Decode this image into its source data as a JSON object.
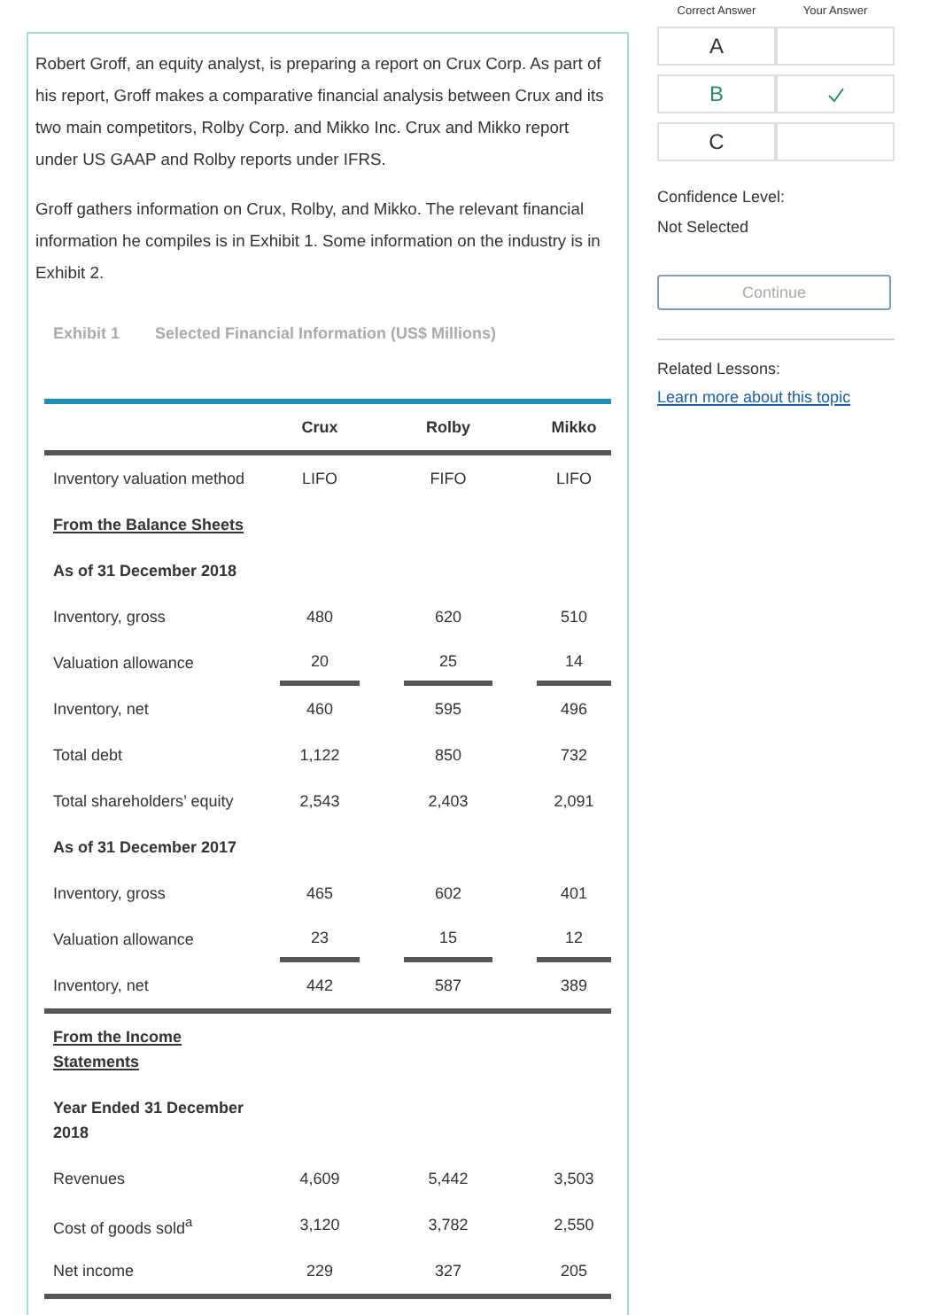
{
  "passage": {
    "paragraphs": [
      "Robert Groff, an equity analyst, is preparing a report on Crux Corp. As part of his report, Groff makes a comparative financial analysis between Crux and its two main competitors, Rolby Corp. and Mikko Inc. Crux and Mikko report under US GAAP and Rolby reports under IFRS.",
      "Groff gathers information on Crux, Rolby, and Mikko. The relevant financial information he compiles is in Exhibit 1. Some information on the industry is in Exhibit 2."
    ]
  },
  "exhibit": {
    "number": "Exhibit 1",
    "title": "Selected Financial Information (US$ Millions)",
    "table": {
      "columns": [
        "Crux",
        "Rolby",
        "Mikko"
      ],
      "rows": [
        {
          "kind": "data",
          "label": "Inventory valuation method",
          "values": [
            "LIFO",
            "FIFO",
            "LIFO"
          ]
        },
        {
          "kind": "section",
          "label": "From the Balance Sheets"
        },
        {
          "kind": "subheading",
          "label": "As of 31 December 2018"
        },
        {
          "kind": "data",
          "label": "Inventory, gross",
          "values": [
            "480",
            "620",
            "510"
          ]
        },
        {
          "kind": "data",
          "label": "Valuation allowance",
          "values": [
            "20",
            "25",
            "14"
          ],
          "subtotal_lines": true
        },
        {
          "kind": "data",
          "label": "Inventory, net",
          "values": [
            "460",
            "595",
            "496"
          ]
        },
        {
          "kind": "data",
          "label": "Total debt",
          "values": [
            "1,122",
            "850",
            "732"
          ]
        },
        {
          "kind": "data",
          "label": "Total shareholders’ equity",
          "values": [
            "2,543",
            "2,403",
            "2,091"
          ]
        },
        {
          "kind": "subheading",
          "label": "As of 31 December 2017"
        },
        {
          "kind": "data",
          "label": "Inventory, gross",
          "values": [
            "465",
            "602",
            "401"
          ]
        },
        {
          "kind": "data",
          "label": "Valuation allowance",
          "values": [
            "23",
            "15",
            "12"
          ],
          "subtotal_lines": true
        },
        {
          "kind": "data",
          "label": "Inventory, net",
          "values": [
            "442",
            "587",
            "389"
          ],
          "rule_below": true
        },
        {
          "kind": "section",
          "label": "From the Income Statements"
        },
        {
          "kind": "subheading",
          "label": "Year Ended 31 December 2018"
        },
        {
          "kind": "data",
          "label": "Revenues",
          "values": [
            "4,609",
            "5,442",
            "3,503"
          ]
        },
        {
          "kind": "data",
          "label": "Cost of goods sold$^{a}$",
          "values": [
            "3,120",
            "3,782",
            "2,550"
          ]
        },
        {
          "kind": "data",
          "label": "Net income",
          "values": [
            "229",
            "327",
            "205"
          ],
          "rule_below": true
        }
      ]
    }
  },
  "answers": {
    "headers": [
      "Correct Answer",
      "Your Answer"
    ],
    "options": [
      {
        "letter": "A",
        "correct": false,
        "selected": false
      },
      {
        "letter": "B",
        "correct": true,
        "selected": true
      },
      {
        "letter": "C",
        "correct": false,
        "selected": false
      }
    ]
  },
  "confidence": {
    "label": "Confidence Level:",
    "value": "Not Selected"
  },
  "continue_button": {
    "label": "Continue",
    "disabled": true
  },
  "related": {
    "label": "Related Lessons:",
    "link": "Learn more about this topic"
  }
}
